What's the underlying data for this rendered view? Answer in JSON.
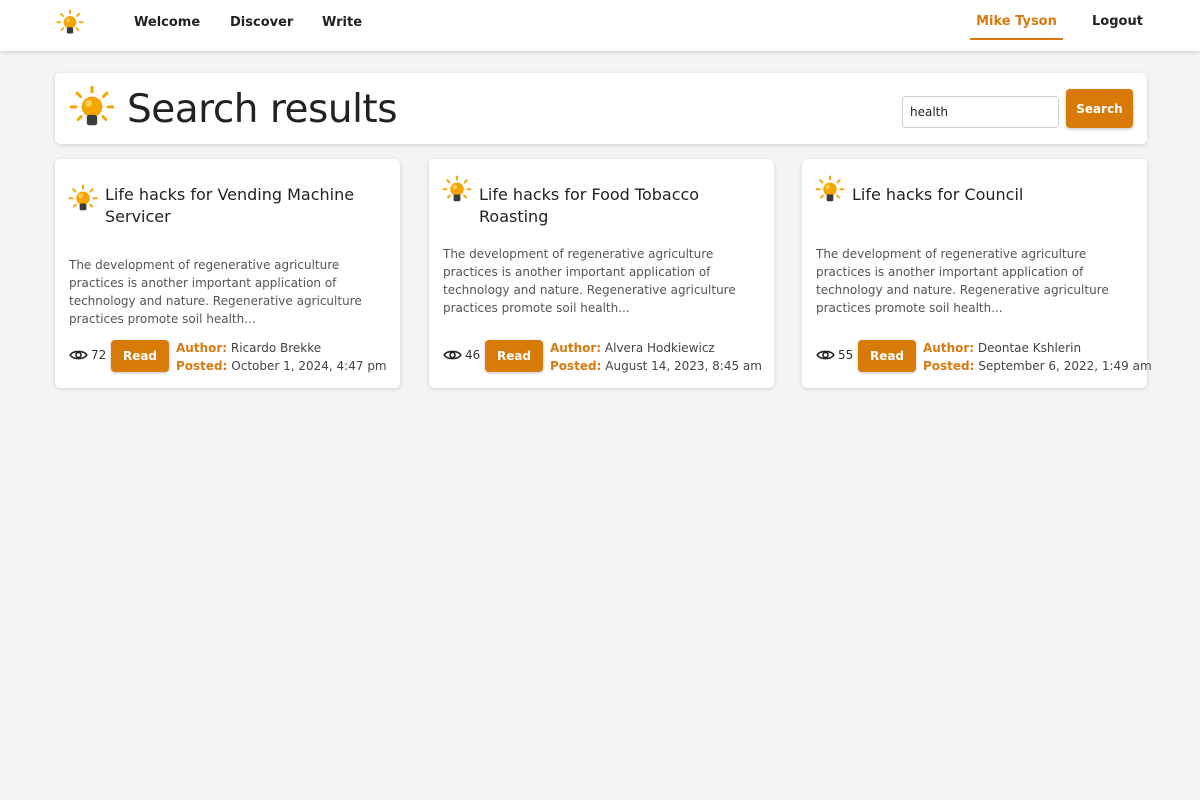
{
  "colors": {
    "accent": "#d87a08",
    "background": "#f4f4f4",
    "card": "#ffffff"
  },
  "nav": {
    "logo_icon": "lightbulb-icon",
    "links": [
      "Welcome",
      "Discover",
      "Write"
    ],
    "user": "Mike Tyson",
    "logout": "Logout"
  },
  "header": {
    "title": "Search results",
    "search": {
      "value": "health",
      "button": "Search"
    }
  },
  "results": [
    {
      "title": "Life hacks for Vending Machine Servicer",
      "excerpt": "The development of regenerative agriculture practices is another important application of technology and nature. Regenerative agriculture practices promote soil health...",
      "views": "72",
      "read_label": "Read",
      "author_label": "Author:",
      "author": "Ricardo Brekke",
      "posted_label": "Posted:",
      "posted": "October 1, 2024, 4:47 pm"
    },
    {
      "title": "Life hacks for Food Tobacco Roasting",
      "excerpt": "The development of regenerative agriculture practices is another important application of technology and nature. Regenerative agriculture practices promote soil health...",
      "views": "46",
      "read_label": "Read",
      "author_label": "Author:",
      "author": "Alvera Hodkiewicz",
      "posted_label": "Posted:",
      "posted": "August 14, 2023, 8:45 am"
    },
    {
      "title": "Life hacks for Council",
      "excerpt": "The development of regenerative agriculture practices is another important application of technology and nature. Regenerative agriculture practices promote soil health...",
      "views": "55",
      "read_label": "Read",
      "author_label": "Author:",
      "author": "Deontae Kshlerin",
      "posted_label": "Posted:",
      "posted": "September 6, 2022, 1:49 am"
    }
  ]
}
